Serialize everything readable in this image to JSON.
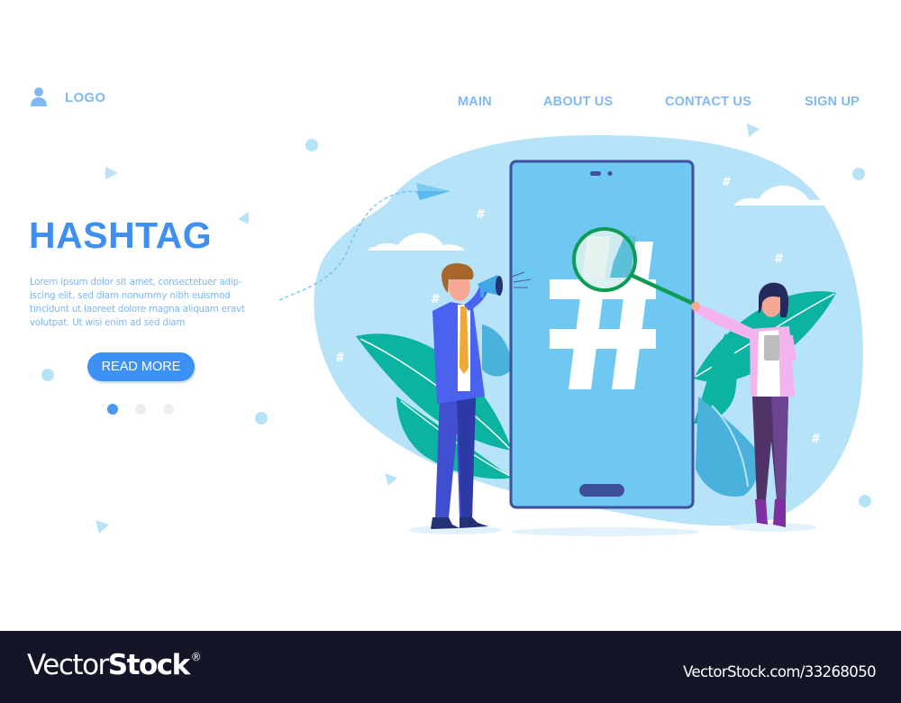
{
  "header": {
    "logo_label": "LOGO",
    "logo_icon": "user-icon",
    "nav": [
      {
        "label": "MAIN"
      },
      {
        "label": "ABOUT US"
      },
      {
        "label": "CONTACT US"
      },
      {
        "label": "SIGN UP"
      }
    ]
  },
  "hero": {
    "title": "HASHTAG",
    "body": "Lorem ipsum dolor sit amet, consectetuer adip- iscing elit, sed diam nonummy nibh euismod tincidunt ut laoreet dolore magna aliquam eravt volutpat. Ut wisi enim ad  sed diam",
    "cta_label": "READ MORE",
    "carousel": {
      "total": 3,
      "active_index": 0
    }
  },
  "illustration": {
    "phone_symbol": "#",
    "icons": [
      "hashtag-icon",
      "megaphone-icon",
      "magnifier-icon",
      "cloud-icon",
      "paper-plane-icon",
      "leaf-icon"
    ]
  },
  "colors": {
    "accent": "#3d91f4",
    "nav_text": "#80b8f5",
    "blob": "#b6e3f8",
    "phone_screen": "#6ec8f2",
    "phone_frame": "#3f4f9c",
    "leaf": "#0bb3a0",
    "magnifier": "#0e9b55",
    "footer_bg": "#141628"
  },
  "footer": {
    "brand_thin": "Vector",
    "brand_bold": "Stock",
    "brand_mark": "®",
    "url": "VectorStock.com/33268050"
  }
}
